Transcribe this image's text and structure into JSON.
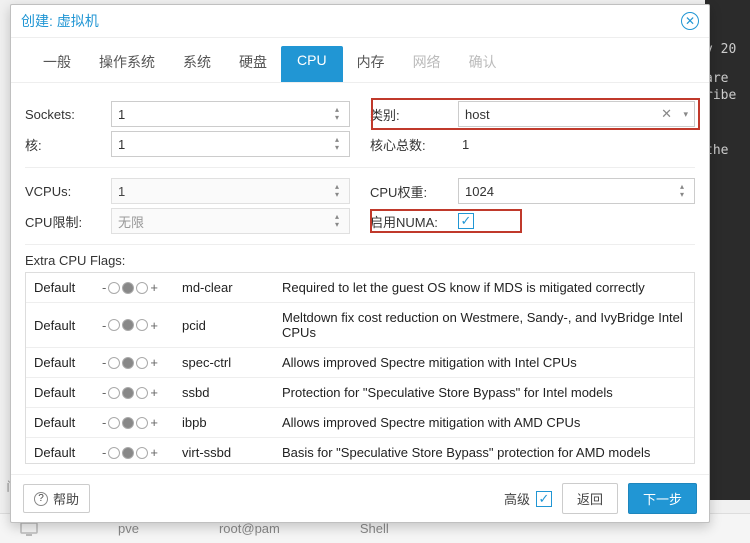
{
  "bg": {
    "l1": "v 20",
    "l2": "are",
    "l3": "ribe",
    "l4": "the"
  },
  "sidebar_label": "间",
  "footer": {
    "node": "pve",
    "user": "root@pam",
    "sess": "Shell"
  },
  "modal": {
    "title": "创建: 虚拟机",
    "tabs": [
      "一般",
      "操作系统",
      "系统",
      "硬盘",
      "CPU",
      "内存",
      "网络",
      "确认"
    ],
    "active_tab": 4,
    "disabled_from": 6,
    "left": {
      "sockets_label": "Sockets:",
      "sockets_val": "1",
      "cores_label": "核:",
      "cores_val": "1",
      "vcpus_label": "VCPUs:",
      "vcpus_val": "1",
      "limit_label": "CPU限制:",
      "limit_val": "无限"
    },
    "right": {
      "type_label": "类别:",
      "type_val": "host",
      "total_label": "核心总数:",
      "total_val": "1",
      "weight_label": "CPU权重:",
      "weight_val": "1024",
      "numa_label": "启用NUMA:",
      "numa_checked": true
    },
    "flags_title": "Extra CPU Flags:",
    "flags": [
      {
        "name": "md-clear",
        "desc": "Required to let the guest OS know if MDS is mitigated correctly"
      },
      {
        "name": "pcid",
        "desc": "Meltdown fix cost reduction on Westmere, Sandy-, and IvyBridge Intel CPUs"
      },
      {
        "name": "spec-ctrl",
        "desc": "Allows improved Spectre mitigation with Intel CPUs"
      },
      {
        "name": "ssbd",
        "desc": "Protection for \"Speculative Store Bypass\" for Intel models"
      },
      {
        "name": "ibpb",
        "desc": "Allows improved Spectre mitigation with AMD CPUs"
      },
      {
        "name": "virt-ssbd",
        "desc": "Basis for \"Speculative Store Bypass\" protection for AMD models"
      }
    ],
    "flag_default_word": "Default",
    "footer": {
      "help": "帮助",
      "advanced": "高级",
      "back": "返回",
      "next": "下一步"
    }
  }
}
